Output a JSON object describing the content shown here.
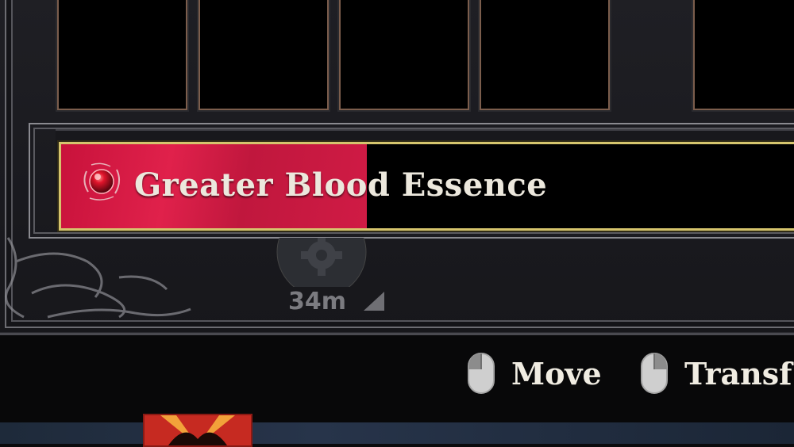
{
  "inventory": {
    "slot_count": 5
  },
  "selected_item": {
    "name": "Greater Blood Essence",
    "icon": "blood-orb-icon",
    "progress_fraction": 0.41,
    "fill_color": "#d01b45",
    "border_color": "#d6c56d"
  },
  "status": {
    "icon": "gear-icon",
    "time": "34m"
  },
  "hints": [
    {
      "icon": "mouse-left-icon",
      "label": "Move"
    },
    {
      "icon": "mouse-right-icon",
      "label": "Transf"
    }
  ]
}
